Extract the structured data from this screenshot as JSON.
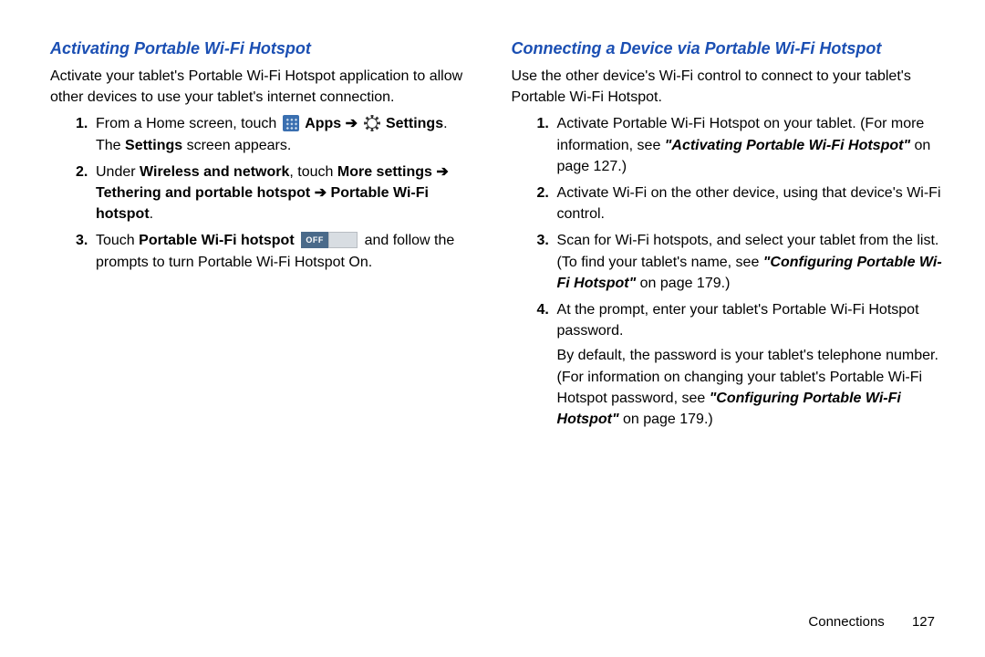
{
  "left": {
    "heading": "Activating Portable Wi-Fi Hotspot",
    "intro": "Activate your tablet's Portable Wi-Fi Hotspot application to allow other devices to use your tablet's internet connection.",
    "s1": {
      "num": "1.",
      "a": "From a Home screen, touch ",
      "apps": "Apps",
      "arrow1": " ➔ ",
      "settings": "Settings",
      "b": ". The ",
      "settings2": "Settings",
      "c": " screen appears."
    },
    "s2": {
      "num": "2.",
      "a": "Under ",
      "wn": "Wireless and network",
      "b": ", touch ",
      "ms": "More settings ➔ Tethering and portable hotspot ➔ Portable Wi-Fi hotspot",
      "c": "."
    },
    "s3": {
      "num": "3.",
      "a": "Touch ",
      "pwh": "Portable Wi-Fi hotspot",
      "off": "OFF",
      "b": " and follow the prompts to turn Portable Wi-Fi Hotspot On."
    }
  },
  "right": {
    "heading": "Connecting a Device via Portable Wi-Fi Hotspot",
    "intro": "Use the other device's Wi-Fi control to connect to your tablet's Portable Wi-Fi Hotspot.",
    "s1": {
      "num": "1.",
      "a": "Activate Portable Wi-Fi Hotspot on your tablet. (For more information, see ",
      "ref": "\"Activating Portable Wi-Fi Hotspot\"",
      "b": " on page 127.)"
    },
    "s2": {
      "num": "2.",
      "a": "Activate Wi-Fi on the other device, using that device's Wi-Fi control."
    },
    "s3": {
      "num": "3.",
      "a": "Scan for Wi-Fi hotspots, and select your tablet from the list. (To find your tablet's name, see ",
      "ref": "\"Configuring Portable Wi-Fi Hotspot\"",
      "b": " on page 179.)"
    },
    "s4": {
      "num": "4.",
      "a": "At the prompt, enter your tablet's Portable Wi-Fi Hotspot password.",
      "sub_a": "By default, the password is your tablet's telephone number. (For information on changing your tablet's Portable Wi-Fi Hotspot password, see ",
      "sub_ref": "\"Configuring Portable Wi-Fi Hotspot\"",
      "sub_b": " on page 179.)"
    }
  },
  "footer": {
    "section": "Connections",
    "page": "127"
  }
}
